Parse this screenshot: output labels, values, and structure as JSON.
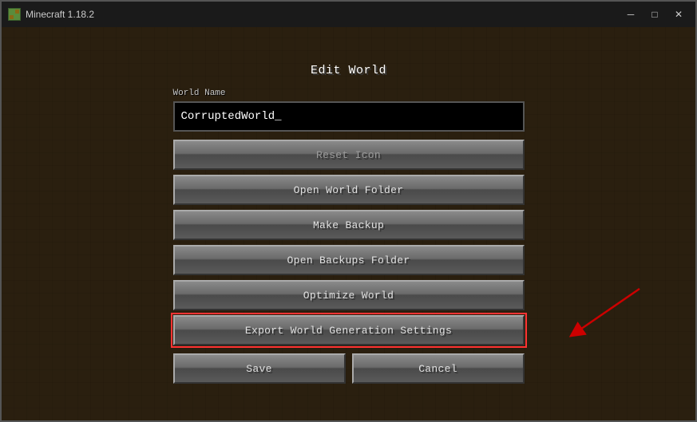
{
  "titleBar": {
    "appIcon": "🎮",
    "title": "Minecraft 1.18.2",
    "minimizeLabel": "─",
    "maximizeLabel": "□",
    "closeLabel": "✕"
  },
  "dialog": {
    "title": "Edit World",
    "fieldLabel": "World Name",
    "worldNameValue": "CorruptedWorld_",
    "worldNamePlaceholder": "World Name",
    "buttons": {
      "resetIcon": "Reset Icon",
      "openWorldFolder": "Open World Folder",
      "makeBackup": "Make Backup",
      "openBackupsFolder": "Open Backups Folder",
      "optimizeWorld": "Optimize World",
      "exportWorldGenerationSettings": "Export World Generation Settings",
      "save": "Save",
      "cancel": "Cancel"
    }
  }
}
